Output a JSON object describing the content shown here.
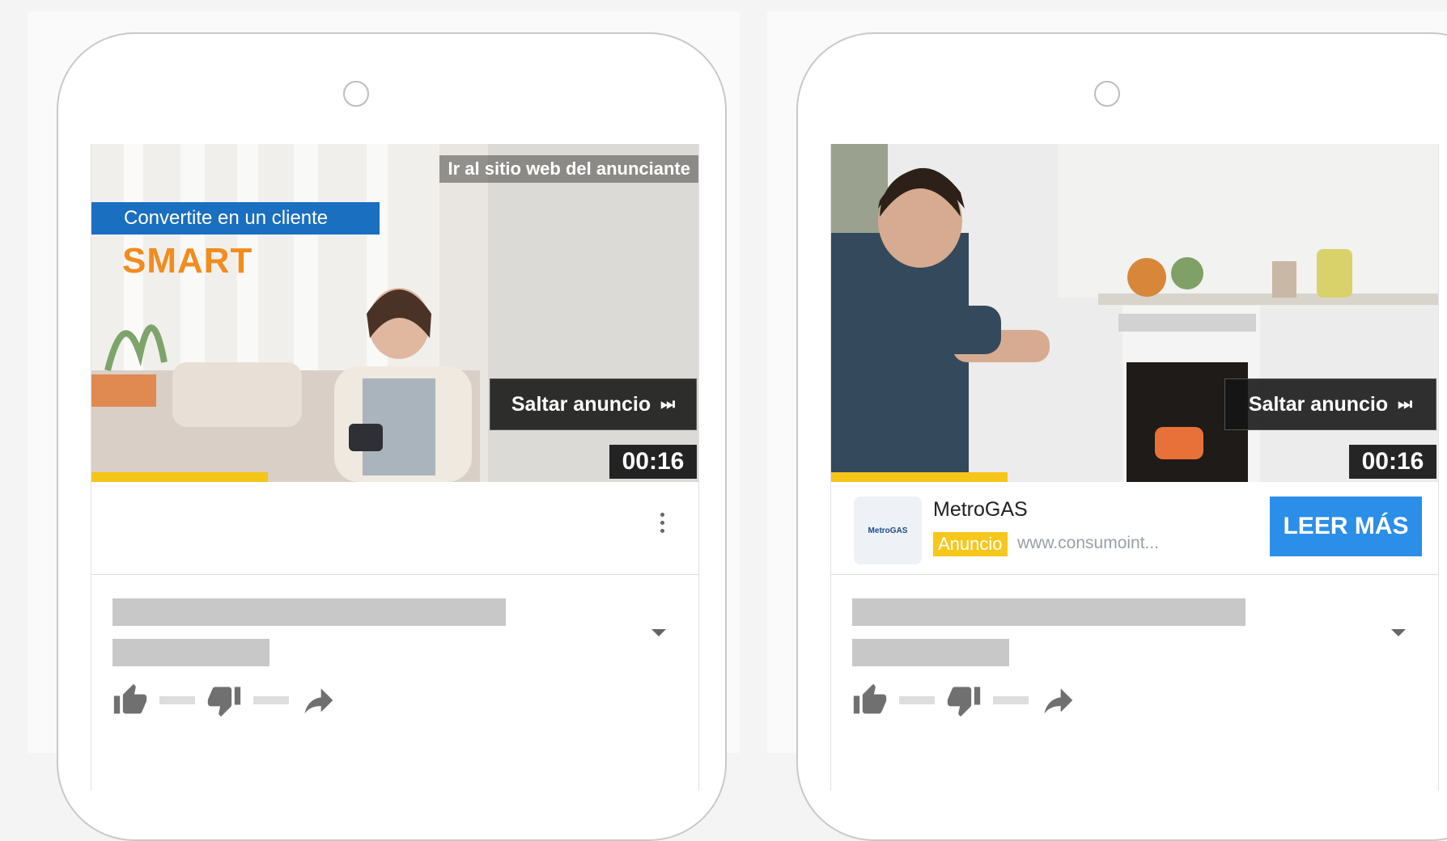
{
  "left_card": {
    "site_link": "Ir al sitio web del anunciante",
    "promo_banner": "Convertite en un cliente",
    "promo_word": "SMART",
    "skip_label": "Saltar anuncio",
    "skip_icon": "⏭",
    "timer": "00:16",
    "progress": 0.29
  },
  "right_card": {
    "skip_label": "Saltar anuncio",
    "skip_icon": "⏭",
    "timer": "00:16",
    "progress": 0.29,
    "advertiser": "MetroGAS",
    "logo_text": "MetroGAS",
    "ad_badge": "Anuncio",
    "ad_url": "www.consumoint...",
    "cta": "LEER MÁS"
  },
  "colors": {
    "progress": "#f5c518",
    "cta": "#2b8ee8",
    "ad_badge": "#f7c71b",
    "promo_banner": "#1a6fc0",
    "promo_word": "#f28c1e"
  },
  "icons": [
    "camera-icon",
    "more-vert-icon",
    "expand-more-icon",
    "thumb-up-icon",
    "thumb-down-icon",
    "share-icon",
    "skip-next-icon"
  ]
}
